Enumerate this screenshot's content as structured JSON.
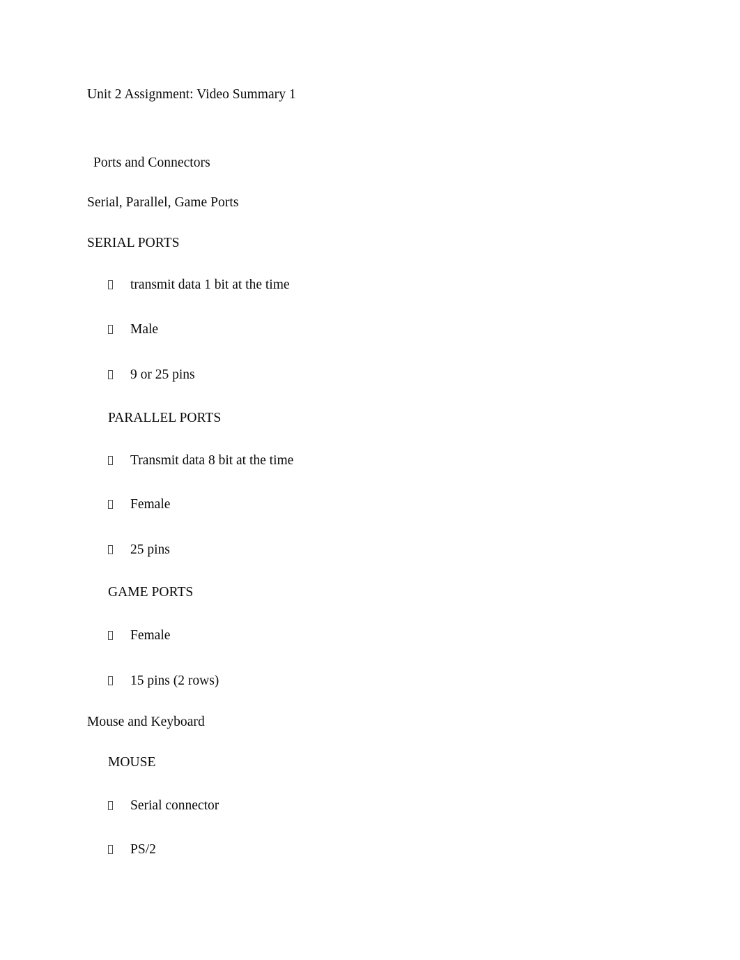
{
  "document": {
    "title": "Unit 2 Assignment: Video Summary 1",
    "background_color": "#ffffff",
    "text_color": "#0a0a0a",
    "bullet_glyph": "missing-glyph-box"
  },
  "blocks": {
    "title": "Unit 2 Assignment: Video Summary 1",
    "topic_heading": " Ports and Connectors",
    "section_1_label": "Serial, Parallel, Game Ports",
    "serial_ports_heading": "SERIAL PORTS",
    "parallel_ports_heading": "PARALLEL PORTS",
    "game_ports_heading": "GAME PORTS",
    "section_2_label": "Mouse and Keyboard",
    "mouse_heading": "MOUSE"
  },
  "bullets": {
    "serial": [
      "transmit data 1 bit at the time",
      "Male",
      "9 or 25 pins"
    ],
    "parallel": [
      "Transmit data 8 bit at the time",
      "Female",
      "25 pins"
    ],
    "game": [
      "Female",
      "15 pins (2 rows)"
    ],
    "mouse": [
      "Serial connector",
      "PS/2"
    ]
  }
}
